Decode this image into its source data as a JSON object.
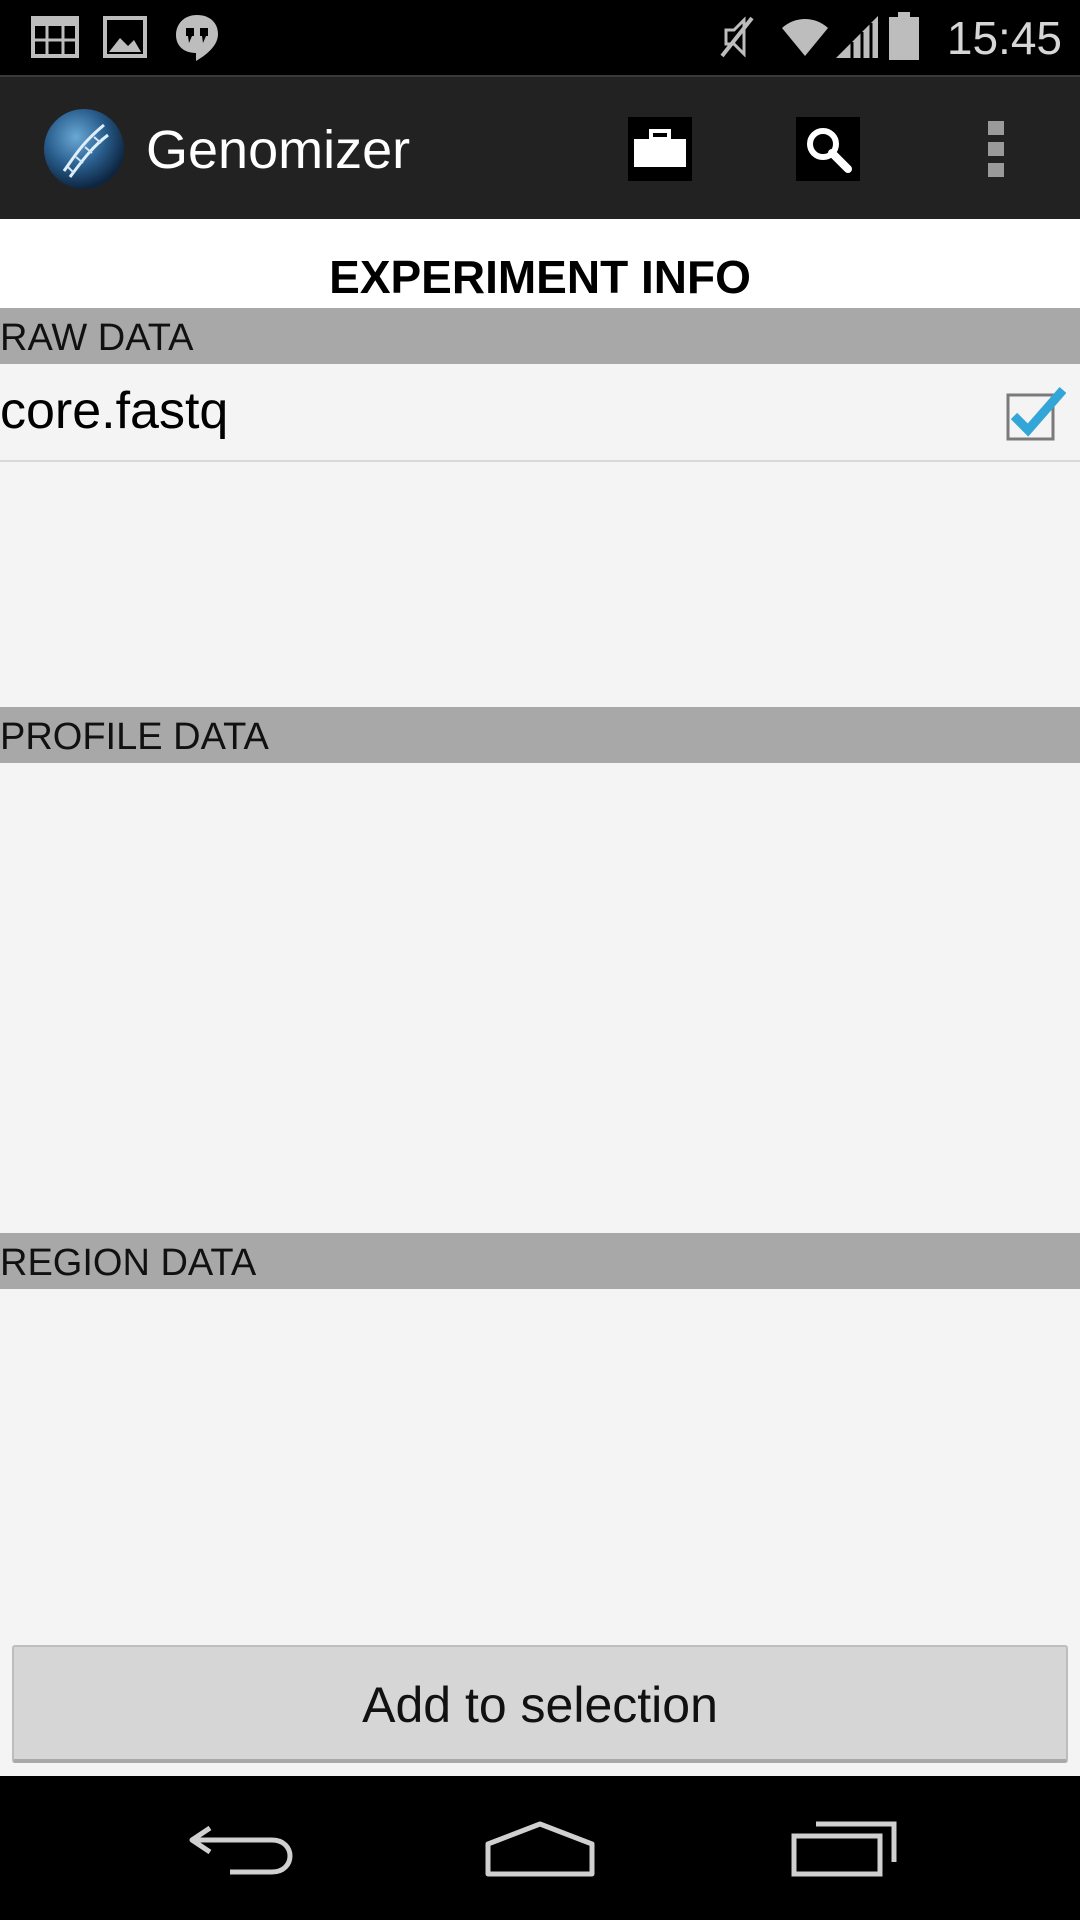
{
  "status_bar": {
    "time": "15:45",
    "left_icons": [
      "calendar-icon",
      "gallery-icon",
      "hangouts-icon"
    ],
    "right_icons": [
      "mute-icon",
      "wifi-icon",
      "signal-icon",
      "battery-icon"
    ]
  },
  "action_bar": {
    "app_title": "Genomizer",
    "actions": [
      "briefcase-icon",
      "search-icon",
      "overflow-menu-icon"
    ]
  },
  "page": {
    "title": "EXPERIMENT INFO"
  },
  "sections": {
    "raw": {
      "header": "RAW DATA",
      "files": [
        {
          "name": "core.fastq",
          "checked": true
        }
      ]
    },
    "profile": {
      "header": "PROFILE DATA"
    },
    "region": {
      "header": "REGION DATA"
    }
  },
  "footer": {
    "add_button_label": "Add to selection"
  },
  "nav_bar": {
    "buttons": [
      "back-icon",
      "home-icon",
      "recents-icon"
    ]
  },
  "colors": {
    "status_bar": "#000000",
    "action_bar": "#222222",
    "section_header": "#a8a8a8",
    "content_bg": "#f4f4f4",
    "checkbox_accent": "#33a6d8"
  }
}
